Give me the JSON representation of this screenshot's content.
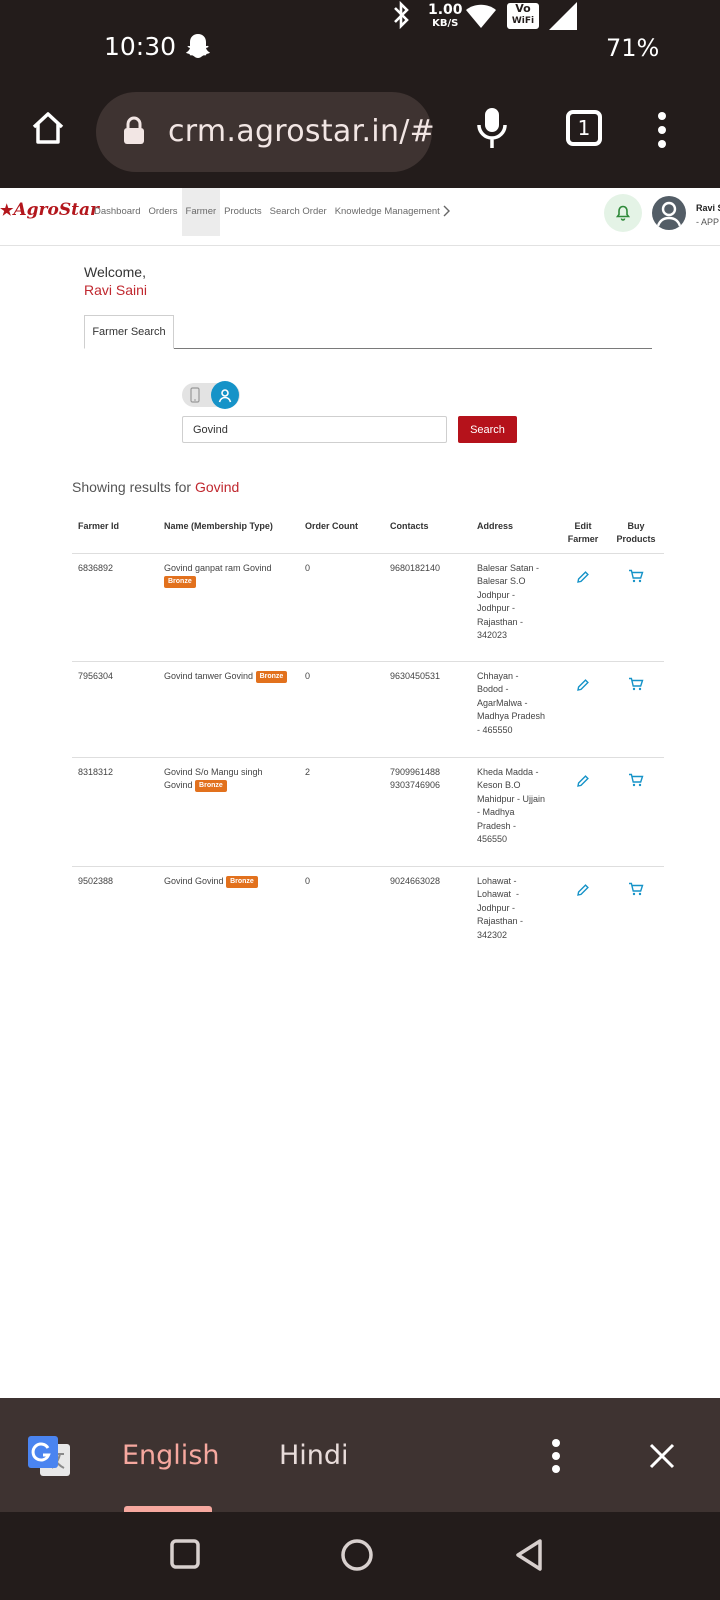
{
  "status_bar": {
    "time": "10:30",
    "net_speed_value": "1.00",
    "net_speed_unit": "KB/S",
    "volte_top": "Vo",
    "volte_bottom": "WiFi",
    "battery": "71%",
    "icons": [
      "snapchat-ghost-icon",
      "bluetooth-icon",
      "wifi-icon",
      "signal-icon"
    ]
  },
  "browser": {
    "url": "crm.agrostar.in/#",
    "tab_count": "1"
  },
  "nav": {
    "brand": "AgroStar",
    "links": [
      {
        "label": "Dashboard",
        "active": false
      },
      {
        "label": "Orders",
        "active": false
      },
      {
        "label": "Farmer",
        "active": true
      },
      {
        "label": "Products",
        "active": false
      },
      {
        "label": "Search Order",
        "active": false
      },
      {
        "label": "Knowledge Management",
        "active": false
      }
    ],
    "user_name": "Ravi S",
    "user_role": "- APP"
  },
  "welcome": {
    "greeting": "Welcome,",
    "name": "Ravi Saini"
  },
  "tabs": {
    "active": "Farmer Search"
  },
  "search": {
    "value": "Govind",
    "button": "Search"
  },
  "results": {
    "prefix": "Showing results for",
    "term": "Govind"
  },
  "table": {
    "headers": {
      "farmer_id": "Farmer Id",
      "name": "Name (Membership Type)",
      "order_count": "Order Count",
      "contacts": "Contacts",
      "address": "Address",
      "edit": "Edit Farmer",
      "buy": "Buy Products"
    },
    "rows": [
      {
        "farmer_id": "6836892",
        "name": "Govind ganpat ram Govind",
        "membership": "Bronze",
        "order_count": "0",
        "contacts": [
          "9680182140"
        ],
        "address": [
          "Balesar Satan -",
          "Balesar S.O",
          "Jodhpur -",
          "Jodhpur -",
          "Rajasthan -",
          "342023"
        ]
      },
      {
        "farmer_id": "7956304",
        "name": "Govind tanwer Govind",
        "membership": "Bronze",
        "order_count": "0",
        "contacts": [
          "9630450531"
        ],
        "address": [
          "Chhayan -",
          "Bodod -",
          "AgarMalwa -",
          "Madhya Pradesh",
          "- 465550"
        ]
      },
      {
        "farmer_id": "8318312",
        "name_line1": "Govind S/o Mangu singh",
        "name_line2": "Govind",
        "membership": "Bronze",
        "order_count": "2",
        "contacts": [
          "7909961488",
          "9303746906"
        ],
        "address": [
          "Kheda Madda -",
          "Keson B.O",
          "Mahidpur - Ujjain",
          "- Madhya",
          "Pradesh -",
          "456550"
        ]
      },
      {
        "farmer_id": "9502388",
        "name": "Govind Govind",
        "membership": "Bronze",
        "order_count": "0",
        "contacts": [
          "9024663028"
        ],
        "address": [
          "Lohawat -",
          "Lohawat  -",
          "Jodhpur -",
          "Rajasthan -",
          "342302"
        ]
      }
    ]
  },
  "translate_bar": {
    "source": "English",
    "target": "Hindi"
  },
  "colors": {
    "primary_red": "#b5121b",
    "bronze": "#e2711d",
    "action_blue": "#1693c8",
    "system_bar": "#231c1b"
  }
}
